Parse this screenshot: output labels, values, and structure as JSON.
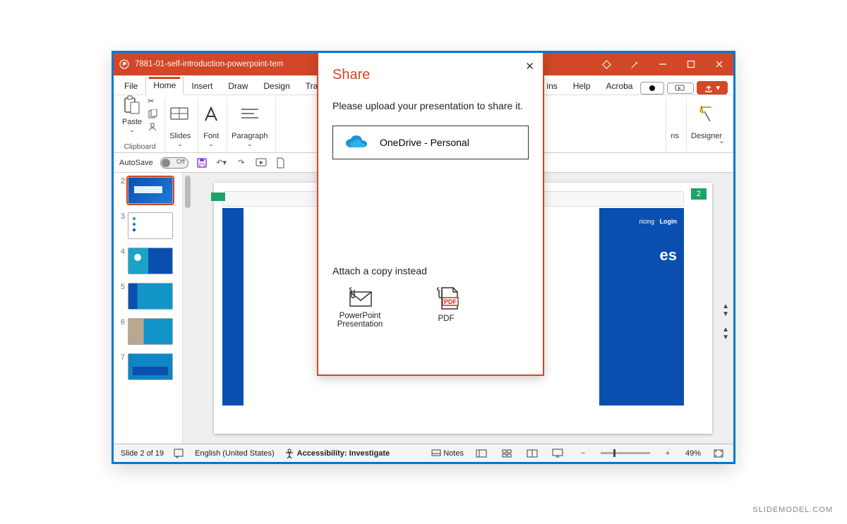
{
  "titlebar": {
    "filename": "7881-01-self-introduction-powerpoint-tem"
  },
  "tabs": {
    "file": "File",
    "home": "Home",
    "insert": "Insert",
    "draw": "Draw",
    "design": "Design",
    "transitions": "Transiti",
    "addins": "ins",
    "help": "Help",
    "acrobat": "Acroba"
  },
  "ribbon": {
    "paste": "Paste",
    "clipboard": "Clipboard",
    "slides": "Slides",
    "font": "Font",
    "paragraph": "Paragraph",
    "designer": "Designer",
    "ns_suffix": "ns"
  },
  "qat": {
    "autosave": "AutoSave"
  },
  "thumbs": [
    2,
    3,
    4,
    5,
    6,
    7
  ],
  "stage": {
    "tag": "2",
    "panel_pricing": "ricing",
    "panel_login": "Login",
    "panel_big": "es"
  },
  "modal": {
    "title": "Share",
    "msg": "Please upload your presentation to share it.",
    "onedrive": "OneDrive - Personal",
    "attach_hdr": "Attach a copy instead",
    "attach_ppt": "PowerPoint Presentation",
    "attach_pdf": "PDF",
    "pdf_tag": "PDF"
  },
  "status": {
    "slide": "Slide 2 of 19",
    "lang": "English (United States)",
    "acc": "Accessibility: Investigate",
    "notes": "Notes",
    "zoom": "49%"
  },
  "watermark": "SLIDEMODEL.COM"
}
